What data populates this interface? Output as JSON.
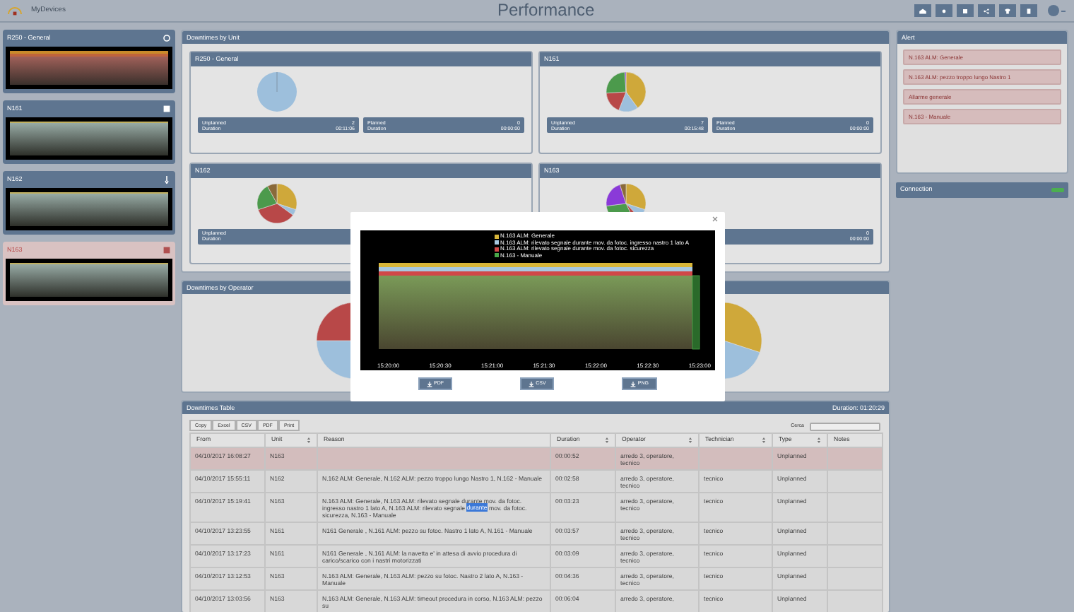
{
  "app": {
    "name": "MyDevices",
    "title": "Performance"
  },
  "devices": [
    {
      "name": "R250 - General",
      "alarm": true,
      "selected": false
    },
    {
      "name": "N161",
      "alarm": false,
      "selected": false
    },
    {
      "name": "N162",
      "alarm": false,
      "selected": false
    },
    {
      "name": "N163",
      "alarm": false,
      "selected": true
    }
  ],
  "units_panel": {
    "title": "Downtimes by Unit",
    "units": [
      {
        "name": "R250 - General",
        "stats": [
          {
            "label": "Unplanned",
            "count": "2",
            "duration_label": "Duration",
            "duration": "00:11:06"
          },
          {
            "label": "Planned",
            "count": "0",
            "duration_label": "Duration",
            "duration": "00:00:00"
          }
        ]
      },
      {
        "name": "N161",
        "stats": [
          {
            "label": "Unplanned",
            "count": "7",
            "duration_label": "Duration",
            "duration": "00:15:48"
          },
          {
            "label": "Planned",
            "count": "0",
            "duration_label": "Duration",
            "duration": "00:00:00"
          }
        ]
      },
      {
        "name": "N162",
        "stats": [
          {
            "label": "Unplanned",
            "duration_label": "Duration"
          }
        ]
      },
      {
        "name": "N163",
        "stats": [
          {
            "count": "0",
            "duration": "00:00:00"
          }
        ]
      }
    ]
  },
  "operator_panel": {
    "title": "Downtimes by Operator"
  },
  "table_panel": {
    "title": "Downtimes Table",
    "total": "Duration: 01:20:29",
    "buttons": [
      "Copy",
      "Excel",
      "CSV",
      "PDF",
      "Print"
    ],
    "search_label": "Cerca",
    "columns": [
      {
        "label": "From",
        "sortable": false
      },
      {
        "label": "Unit",
        "sortable": true
      },
      {
        "label": "Reason",
        "sortable": false
      },
      {
        "label": "Duration",
        "sortable": true
      },
      {
        "label": "Operator",
        "sortable": true
      },
      {
        "label": "Technician",
        "sortable": true
      },
      {
        "label": "Type",
        "sortable": true
      },
      {
        "label": "Notes",
        "sortable": false
      }
    ],
    "rows": [
      {
        "selected": true,
        "cells": [
          "04/10/2017 16:08:27",
          "N163",
          "",
          "00:00:52",
          "arredo 3, operatore, tecnico",
          "",
          "Unplanned",
          ""
        ]
      },
      {
        "selected": false,
        "cells": [
          "04/10/2017 15:55:11",
          "N162",
          "N.162 ALM: Generale, N.162 ALM: pezzo troppo lungo Nastro 1, N.162 - Manuale",
          "00:02:58",
          "arredo 3, operatore, tecnico",
          "tecnico",
          "Unplanned",
          ""
        ]
      },
      {
        "selected": false,
        "cells": [
          "04/10/2017 15:19:41",
          "N163",
          [
            {
              "text": "N.163 ALM: Generale, N.163 ALM: rilevato segnale durante mov. da fotoc. ingresso nastro 1 lato A, N.163 ALM: rilevato segnale ",
              "highlighted": false
            },
            {
              "text": "durante",
              "highlighted": true
            },
            {
              "text": " mov. da fotoc. sicurezza, N.163 - Manuale",
              "highlighted": false
            }
          ],
          "00:03:23",
          "arredo 3, operatore, tecnico",
          "tecnico",
          "Unplanned",
          ""
        ]
      },
      {
        "selected": false,
        "cells": [
          "04/10/2017 13:23:55",
          "N161",
          "N161 Generale , N.161 ALM: pezzo su fotoc. Nastro 1 lato A, N.161 - Manuale",
          "00:03:57",
          "arredo 3, operatore, tecnico",
          "tecnico",
          "Unplanned",
          ""
        ]
      },
      {
        "selected": false,
        "cells": [
          "04/10/2017 13:17:23",
          "N161",
          "N161 Generale , N.161 ALM: la navetta e' in attesa di avvio procedura di carico/scarico con i nastri motorizzati",
          "00:03:09",
          "arredo 3, operatore, tecnico",
          "tecnico",
          "Unplanned",
          ""
        ]
      },
      {
        "selected": false,
        "cells": [
          "04/10/2017 13:12:53",
          "N163",
          "N.163 ALM: Generale, N.163 ALM: pezzo su fotoc. Nastro 2 lato A, N.163 - Manuale",
          "00:04:36",
          "arredo 3, operatore, tecnico",
          "tecnico",
          "Unplanned",
          ""
        ]
      },
      {
        "selected": false,
        "cells": [
          "04/10/2017 13:03:56",
          "N163",
          "N.163 ALM: Generale, N.163 ALM: timeout procedura in corso, N.163 ALM: pezzo su",
          "00:06:04",
          "arredo 3, operatore,",
          "tecnico",
          "Unplanned",
          ""
        ]
      }
    ]
  },
  "alert_panel": {
    "title": "Alert",
    "items": [
      "N.163 ALM: Generale",
      "N.163 ALM: pezzo troppo lungo Nastro 1",
      "Allarme generale",
      "N.163 - Manuale"
    ]
  },
  "connection": {
    "title": "Connection",
    "connected": true
  },
  "modal": {
    "legend": [
      {
        "label": "N.163 ALM: Generale",
        "color": "#d8b63a"
      },
      {
        "label": "N.163 ALM: rilevato segnale durante mov. da fotoc. ingresso nastro 1 lato A",
        "color": "#a8c8e0"
      },
      {
        "label": "N.163 ALM: rilevato segnale durante mov. da fotoc. sicurezza",
        "color": "#d04848"
      },
      {
        "label": "N.163 - Manuale",
        "color": "#4aa84a"
      }
    ],
    "x_ticks": [
      "15:20:00",
      "15:20:30",
      "15:21:00",
      "15:21:30",
      "15:22:00",
      "15:22:30",
      "15:23:00"
    ],
    "buttons": [
      "PDF",
      "CSV",
      "PNG"
    ]
  }
}
